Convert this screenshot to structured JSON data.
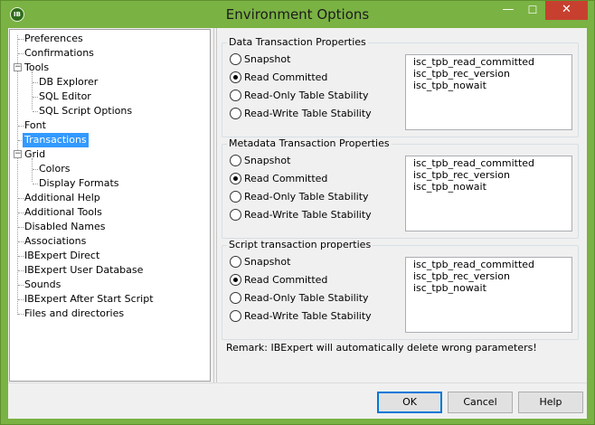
{
  "window": {
    "title": "Environment Options",
    "app_icon_text": "IB",
    "minimize_glyph": "—",
    "maximize_glyph": "☐",
    "close_glyph": "✕"
  },
  "tree": {
    "items": [
      {
        "label": "Preferences"
      },
      {
        "label": "Confirmations"
      },
      {
        "label": "Tools",
        "expander": "−"
      },
      {
        "label": "DB Explorer"
      },
      {
        "label": "SQL Editor"
      },
      {
        "label": "SQL Script Options"
      },
      {
        "label": "Font"
      },
      {
        "label": "Transactions",
        "selected": true
      },
      {
        "label": "Grid",
        "expander": "−"
      },
      {
        "label": "Colors"
      },
      {
        "label": "Display Formats"
      },
      {
        "label": "Additional Help"
      },
      {
        "label": "Additional Tools"
      },
      {
        "label": "Disabled Names"
      },
      {
        "label": "Associations"
      },
      {
        "label": "IBExpert Direct"
      },
      {
        "label": "IBExpert User Database"
      },
      {
        "label": "Sounds"
      },
      {
        "label": "IBExpert After Start Script"
      },
      {
        "label": "Files and directories"
      }
    ]
  },
  "groups": [
    {
      "title": "Data Transaction Properties",
      "options": [
        "Snapshot",
        "Read Committed",
        "Read-Only Table Stability",
        "Read-Write Table Stability"
      ],
      "selected": "Read Committed",
      "params": [
        "isc_tpb_read_committed",
        "isc_tpb_rec_version",
        "isc_tpb_nowait"
      ]
    },
    {
      "title": "Metadata Transaction Properties",
      "options": [
        "Snapshot",
        "Read Committed",
        "Read-Only Table Stability",
        "Read-Write Table Stability"
      ],
      "selected": "Read Committed",
      "params": [
        "isc_tpb_read_committed",
        "isc_tpb_rec_version",
        "isc_tpb_nowait"
      ]
    },
    {
      "title": "Script transaction properties",
      "options": [
        "Snapshot",
        "Read Committed",
        "Read-Only Table Stability",
        "Read-Write Table Stability"
      ],
      "selected": "Read Committed",
      "params": [
        "isc_tpb_read_committed",
        "isc_tpb_rec_version",
        "isc_tpb_nowait"
      ]
    }
  ],
  "remark": "Remark: IBExpert will automatically delete wrong parameters!",
  "buttons": {
    "ok": "OK",
    "cancel": "Cancel",
    "help": "Help"
  }
}
